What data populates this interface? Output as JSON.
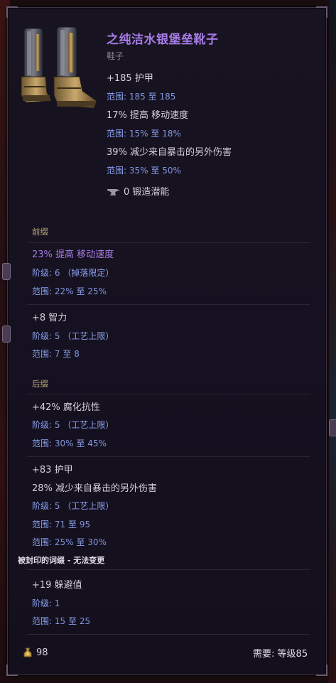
{
  "item": {
    "name": "之纯洁水银堡垒靴子",
    "type": "鞋子",
    "implicits": [
      {
        "stat": "+185 护甲",
        "range_label": "范围",
        "range_min": "185",
        "range_sep": "至",
        "range_max": "185"
      },
      {
        "stat": "17% 提高 移动速度",
        "range_label": "范围",
        "range_min": "15%",
        "range_sep": "至",
        "range_max": "18%"
      },
      {
        "stat": "39% 减少来自暴击的另外伤害",
        "range_label": "范围",
        "range_min": "35%",
        "range_sep": "至",
        "range_max": "50%"
      }
    ],
    "forge_potential": "0 锻造潜能"
  },
  "prefixes": {
    "header": "前缀",
    "mods": [
      {
        "stat": "23% 提高 移动速度",
        "tier_label": "阶级",
        "tier_value": "6",
        "tier_note": "（掉落限定）",
        "ranges": [
          {
            "label": "范围",
            "min": "22%",
            "sep": "至",
            "max": "25%"
          }
        ]
      },
      {
        "stat": "+8 智力",
        "tier_label": "阶级",
        "tier_value": "5",
        "tier_note": "（工艺上限）",
        "ranges": [
          {
            "label": "范围",
            "min": "7",
            "sep": "至",
            "max": "8"
          }
        ]
      }
    ]
  },
  "suffixes": {
    "header": "后缀",
    "mods": [
      {
        "stat": "+42% 腐化抗性",
        "tier_label": "阶级",
        "tier_value": "5",
        "tier_note": "（工艺上限）",
        "ranges": [
          {
            "label": "范围",
            "min": "30%",
            "sep": "至",
            "max": "45%"
          }
        ]
      },
      {
        "stat": "+83 护甲",
        "stat2": "28% 减少来自暴击的另外伤害",
        "tier_label": "阶级",
        "tier_value": "5",
        "tier_note": "（工艺上限）",
        "ranges": [
          {
            "label": "范围",
            "min": "71",
            "sep": "至",
            "max": "95"
          },
          {
            "label": "范围",
            "min": "25%",
            "sep": "至",
            "max": "30%"
          }
        ]
      }
    ]
  },
  "sealed": {
    "header": "被封印的词缀 - 无法变更",
    "mod": {
      "stat": "+19 躲避值",
      "tier_label": "阶级",
      "tier_value": "1",
      "ranges": [
        {
          "label": "范围",
          "min": "15",
          "sep": "至",
          "max": "25"
        }
      ]
    }
  },
  "footer": {
    "value": "98",
    "req_label": "需要:",
    "req_level_label": "等级",
    "req_level": "85"
  },
  "icons": [
    "boots-icon",
    "forge-anvil-icon",
    "coin-bag-icon"
  ],
  "colors": {
    "item_name": "#a77be6",
    "range": "#8294dc",
    "section_header": "#b7a57a",
    "text": "#d6d0da"
  }
}
